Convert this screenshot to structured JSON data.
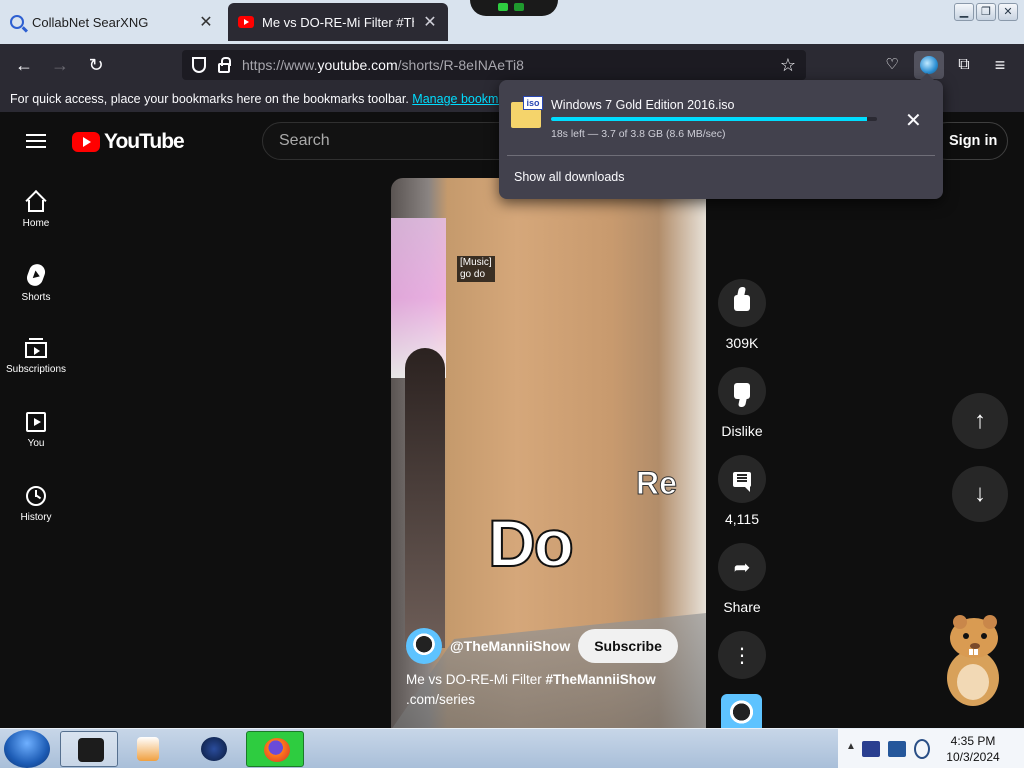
{
  "browser": {
    "tabs": [
      {
        "title": "CollabNet SearXNG",
        "icon": "search-icon",
        "active": false
      },
      {
        "title": "Me vs DO-RE-Mi Filter #TheMannii",
        "icon": "youtube-icon",
        "active": true
      }
    ],
    "url_prefix": "https://www.",
    "url_domain": "youtube.com",
    "url_path": "/shorts/R-8eINAeTi8",
    "bookmarks_text": "For quick access, place your bookmarks here on the bookmarks toolbar.",
    "bookmarks_link": "Manage bookmarks..."
  },
  "download": {
    "filename": "Windows 7 Gold Edition 2016.iso",
    "file_badge": "iso",
    "status": "18s left — 3.7 of 3.8 GB (8.6 MB/sec)",
    "progress": 0.97,
    "show_all": "Show all downloads"
  },
  "youtube": {
    "logo": "YouTube",
    "search_placeholder": "Search",
    "sign_in": "Sign in",
    "sidebar": [
      {
        "label": "Home",
        "icon": "home-icon"
      },
      {
        "label": "Shorts",
        "icon": "shorts-icon"
      },
      {
        "label": "Subscriptions",
        "icon": "subscriptions-icon"
      },
      {
        "label": "You",
        "icon": "you-icon"
      },
      {
        "label": "History",
        "icon": "history-icon"
      }
    ],
    "video": {
      "caption": "[Music]\ngo do",
      "overlay_do": "Do",
      "overlay_re": "Re",
      "channel": "@TheManniiShow",
      "subscribe": "Subscribe",
      "title_plain": "Me vs DO-RE-Mi Filter ",
      "title_tag": "#TheManniiShow",
      "title_line2": ".com/series"
    },
    "actions": {
      "likes": "309K",
      "dislike": "Dislike",
      "comments": "4,115",
      "share": "Share"
    }
  },
  "taskbar": {
    "time": "4:35 PM",
    "date": "10/3/2024"
  },
  "colors": {
    "youtube_red": "#ff0000",
    "download_progress": "#00ddff",
    "firefox_bg": "#2b2a33"
  }
}
